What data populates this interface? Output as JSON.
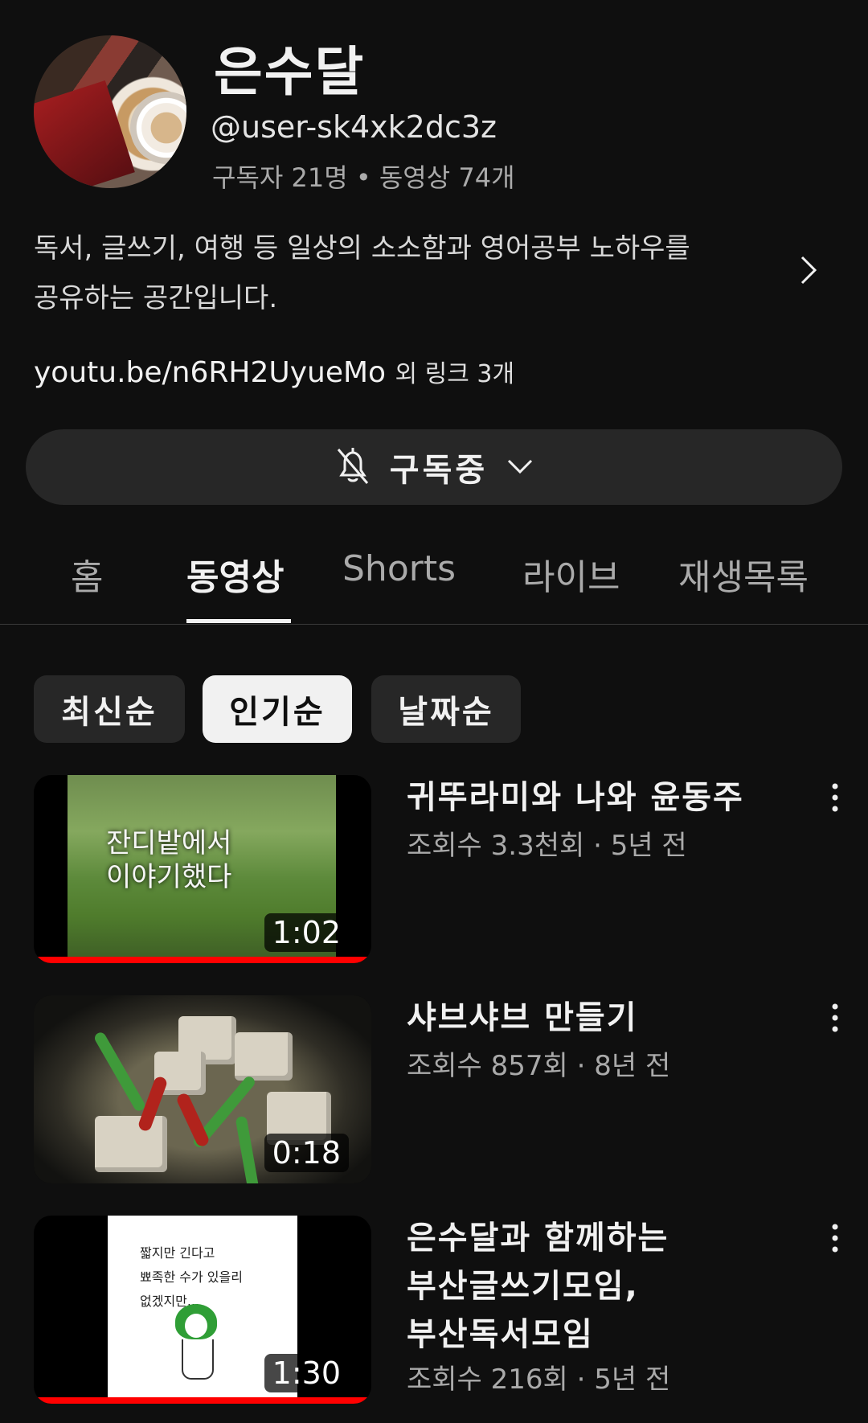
{
  "channel": {
    "name": "은수달",
    "handle": "@user-sk4xk2dc3z",
    "stats": "구독자 21명 • 동영상 74개",
    "description": "독서, 글쓰기, 여행 등 일상의 소소함과 영어공부 노하우를\n공유하는 공간입니다.",
    "link_text": "youtu.be/n6RH2UyueMo",
    "link_more": "외 링크 3개"
  },
  "subscribe": {
    "label": "구독중",
    "icon": "bell-off-icon"
  },
  "tabs": [
    "홈",
    "동영상",
    "Shorts",
    "라이브",
    "재생목록"
  ],
  "active_tab": "동영상",
  "sort_chips": [
    "최신순",
    "인기순",
    "날짜순"
  ],
  "active_chip": "인기순",
  "videos": [
    {
      "title": "귀뚜라미와 나와 윤동주",
      "meta": "조회수 3.3천회 · 5년 전",
      "duration": "1:02",
      "thumb_text": "잔디밭에서\n이야기했다",
      "watched_fraction": 1.0
    },
    {
      "title": "샤브샤브 만들기",
      "meta": "조회수 857회 · 8년 전",
      "duration": "0:18",
      "watched_fraction": 0
    },
    {
      "title": "은수달과 함께하는\n부산글쓰기모임,\n부산독서모임",
      "meta": "조회수 216회 · 5년 전",
      "duration": "1:30",
      "thumb_text": "짧지만 긴다고\n뾰족한 수가 있을리\n없겠지만...",
      "watched_fraction": 1.0
    }
  ],
  "colors": {
    "background": "#0f0f0f",
    "surface": "#272727",
    "progress": "#ff0000",
    "secondary_text": "#aaaaaa"
  }
}
